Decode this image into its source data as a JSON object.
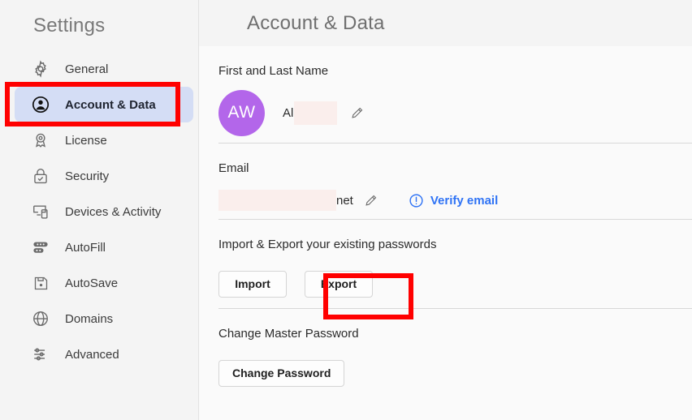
{
  "sidebar": {
    "title": "Settings",
    "items": [
      {
        "label": "General",
        "icon": "gear-icon",
        "active": false
      },
      {
        "label": "Account & Data",
        "icon": "account-circle-icon",
        "active": true
      },
      {
        "label": "License",
        "icon": "award-ribbon-icon",
        "active": false
      },
      {
        "label": "Security",
        "icon": "padlock-check-icon",
        "active": false
      },
      {
        "label": "Devices & Activity",
        "icon": "devices-icon",
        "active": false
      },
      {
        "label": "AutoFill",
        "icon": "autofill-icon",
        "active": false
      },
      {
        "label": "AutoSave",
        "icon": "floppy-disk-icon",
        "active": false
      },
      {
        "label": "Domains",
        "icon": "globe-icon",
        "active": false
      },
      {
        "label": "Advanced",
        "icon": "sliders-icon",
        "active": false
      }
    ]
  },
  "header": {
    "title": "Account & Data"
  },
  "name_section": {
    "label": "First and Last Name",
    "avatar_initials": "AW",
    "avatar_color": "#b366ea",
    "value_prefix": "Al",
    "value_suffix": "",
    "edit_icon": "pencil-icon"
  },
  "email_section": {
    "label": "Email",
    "value_suffix": "net",
    "edit_icon": "pencil-icon",
    "verify_label": "Verify email",
    "verify_icon": "exclamation-circle-icon",
    "verify_color": "#2f73f5"
  },
  "import_export_section": {
    "label": "Import & Export your existing passwords",
    "import_label": "Import",
    "export_label": "Export"
  },
  "password_section": {
    "label": "Change Master Password",
    "change_label": "Change Password"
  },
  "annotations": {
    "highlight_color": "#ff0000",
    "boxes": [
      "account-and-data-nav-item",
      "export-button"
    ]
  }
}
